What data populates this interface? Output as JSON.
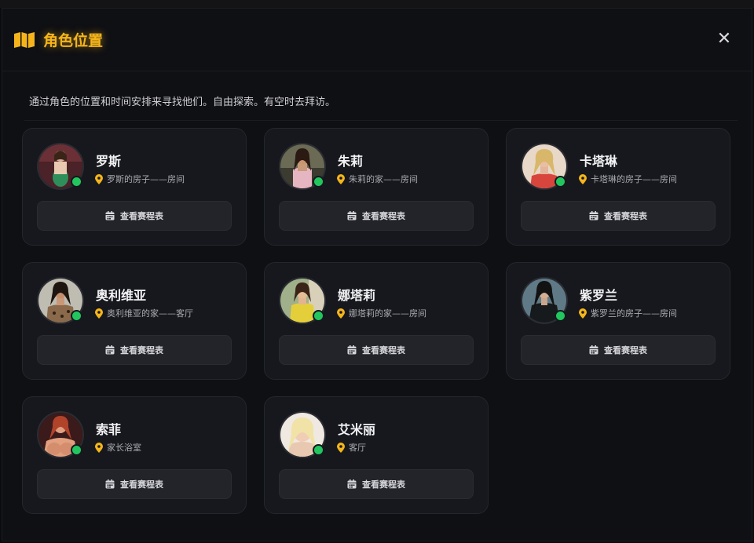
{
  "modal": {
    "title": "角色位置",
    "title_icon": "map-icon",
    "close_icon": "close-icon",
    "close_label": "✕",
    "description": "通过角色的位置和时间安排来寻找他们。自由探索。有空时去拜访。"
  },
  "colors": {
    "accent": "#f5b51a",
    "online": "#22c55e",
    "card_bg": "#16181d",
    "button_bg": "#22242a"
  },
  "characters": [
    {
      "name": "罗斯",
      "location": "罗斯的房子——房间",
      "button": "查看赛程表",
      "status": "online"
    },
    {
      "name": "朱莉",
      "location": "朱莉的家——房间",
      "button": "查看赛程表",
      "status": "online"
    },
    {
      "name": "卡塔琳",
      "location": "卡塔琳的房子——房间",
      "button": "查看赛程表",
      "status": "online"
    },
    {
      "name": "奥利维亚",
      "location": "奥利维亚的家——客厅",
      "button": "查看赛程表",
      "status": "online"
    },
    {
      "name": "娜塔莉",
      "location": "娜塔莉的家——房间",
      "button": "查看赛程表",
      "status": "online"
    },
    {
      "name": "紫罗兰",
      "location": "紫罗兰的房子——房间",
      "button": "查看赛程表",
      "status": "online"
    },
    {
      "name": "索菲",
      "location": "家长浴室",
      "button": "查看赛程表",
      "status": "online"
    },
    {
      "name": "艾米丽",
      "location": "客厅",
      "button": "查看赛程表",
      "status": "online"
    }
  ]
}
